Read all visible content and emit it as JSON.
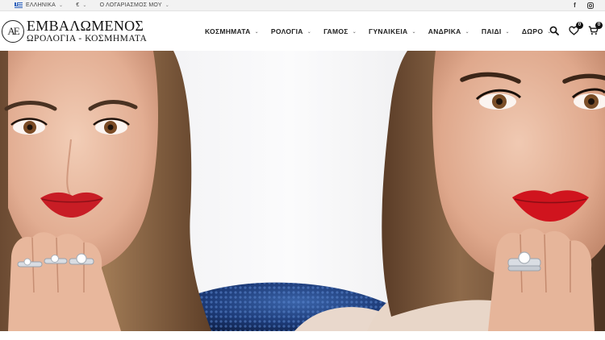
{
  "topbar": {
    "language": "ΕΛΛΗΝΙΚΑ",
    "currency": "€",
    "account": "Ο ΛΟΓΑΡΙΑΣΜΟΣ ΜΟΥ",
    "social": {
      "facebook_icon": "facebook-icon",
      "instagram_icon": "instagram-icon"
    }
  },
  "brand": {
    "monogram": "ΑΕ",
    "name": "ΕΜΒΑΛΩΜΕΝΟΣ",
    "tagline": "ΩΡΟΛΟΓΙΑ - ΚΟΣΜΗΜΑΤΑ"
  },
  "nav": {
    "items": [
      {
        "label": "ΚΟΣΜΗΜΑΤΑ"
      },
      {
        "label": "ΡΟΛΟΓΙΑ"
      },
      {
        "label": "ΓΑΜΟΣ"
      },
      {
        "label": "ΓΥΝΑΙΚΕΙΑ"
      },
      {
        "label": "ΑΝΔΡΙΚΑ"
      },
      {
        "label": "ΠΑΙΔΙ"
      },
      {
        "label": "ΔΩΡΟ"
      }
    ]
  },
  "header_actions": {
    "wishlist_count": "0",
    "cart_count": "0"
  },
  "colors": {
    "accent": "#111111",
    "topbar_bg": "#f2f2f2",
    "lip_red": "#c81d25"
  }
}
